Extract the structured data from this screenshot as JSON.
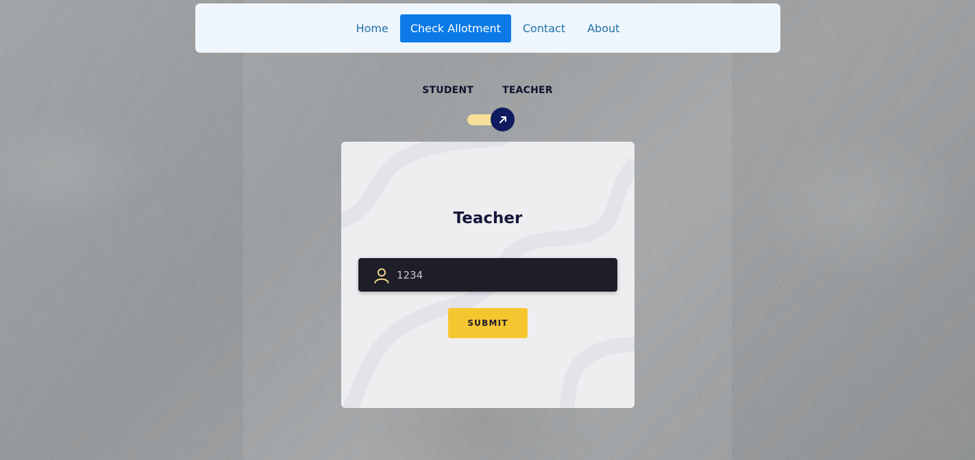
{
  "nav": {
    "items": [
      {
        "label": "Home"
      },
      {
        "label": "Check Allotment",
        "active": true
      },
      {
        "label": "Contact"
      },
      {
        "label": "About"
      }
    ]
  },
  "role_toggle": {
    "student_label": "STUDENT",
    "teacher_label": "TEACHER",
    "selected": "TEACHER",
    "knob_icon": "arrow-up-right-icon"
  },
  "card": {
    "title": "Teacher",
    "input": {
      "value": "1234",
      "icon": "user-icon"
    },
    "submit_label": "SUBMIT"
  },
  "colors": {
    "nav_active": "#0b7ae6",
    "nav_text": "#1f6fa8",
    "accent_yellow": "#f6c631",
    "knob_navy": "#101a5e",
    "input_bg": "#1e1e28"
  }
}
